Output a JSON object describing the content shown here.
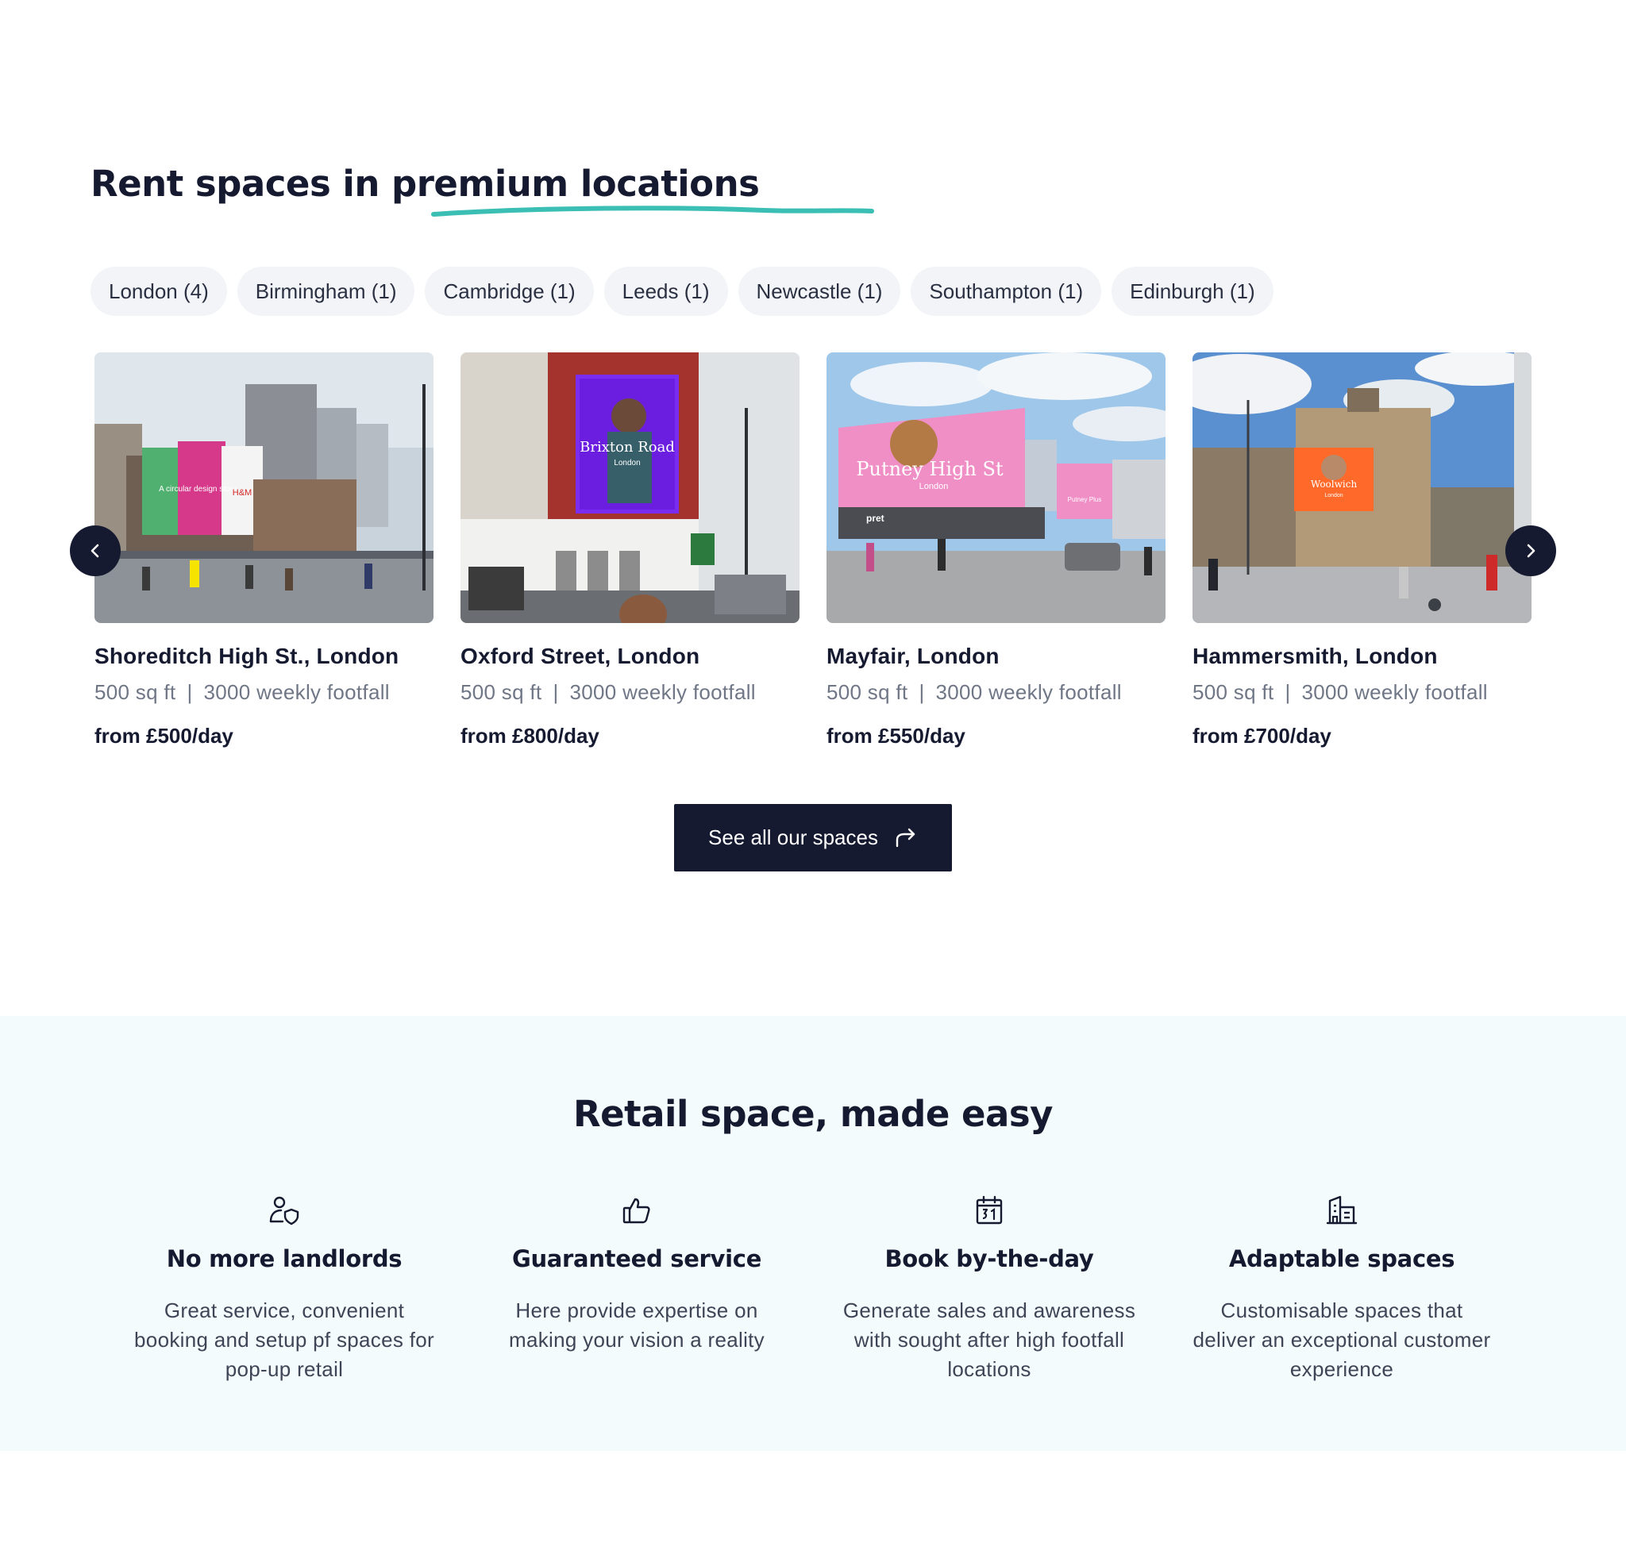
{
  "hero": {
    "title_part1": "Rent spaces in ",
    "title_highlight": "premium locations",
    "underline_color": "#3bbfb5"
  },
  "filters": [
    {
      "label": "London (4)"
    },
    {
      "label": "Birmingham (1)"
    },
    {
      "label": "Cambridge (1)"
    },
    {
      "label": "Leeds (1)"
    },
    {
      "label": "Newcastle (1)"
    },
    {
      "label": "Southampton (1)"
    },
    {
      "label": "Edinburgh (1)"
    }
  ],
  "carousel": {
    "prev_icon": "chevron-left-icon",
    "next_icon": "chevron-right-icon",
    "cards": [
      {
        "title": "Shoreditch High St., London",
        "size": "500 sq ft",
        "separator": "|",
        "footfall": "3000 weekly footfall",
        "price": "from £500/day",
        "billboard_text": "A circular design story",
        "billboard_brand": "H&M"
      },
      {
        "title": "Oxford Street, London",
        "size": "500 sq ft",
        "separator": "|",
        "footfall": "3000 weekly footfall",
        "price": "from £800/day",
        "billboard_text": "Brixton Road",
        "billboard_sub": "London"
      },
      {
        "title": "Mayfair, London",
        "size": "500 sq ft",
        "separator": "|",
        "footfall": "3000 weekly footfall",
        "price": "from £550/day",
        "billboard_text": "Putney High St",
        "billboard_sub": "London",
        "billboard_small": "Putney Plus",
        "shop_sign": "pret"
      },
      {
        "title": "Hammersmith, London",
        "size": "500 sq ft",
        "separator": "|",
        "footfall": "3000 weekly footfall",
        "price": "from £700/day",
        "billboard_text": "Woolwich",
        "billboard_sub": "London"
      }
    ]
  },
  "cta": {
    "label": "See all our spaces",
    "icon": "redo-arrow-icon"
  },
  "easy": {
    "title": "Retail space, made easy",
    "features": [
      {
        "icon": "user-shield-icon",
        "title": "No more landlords",
        "description": "Great service, convenient booking and setup pf spaces for pop-up retail"
      },
      {
        "icon": "thumbs-up-icon",
        "title": "Guaranteed service",
        "description": "Here provide expertise on making your vision a reality"
      },
      {
        "icon": "calendar-31-icon",
        "title": "Book by-the-day",
        "description": "Generate sales and awareness with sought after high footfall locations"
      },
      {
        "icon": "building-icon",
        "title": "Adaptable spaces",
        "description": "Customisable spaces that deliver an exceptional customer experience"
      }
    ]
  },
  "colors": {
    "navy": "#161a30",
    "chip_bg": "#f2f4f7",
    "easy_bg": "#f3fbfc",
    "muted_text": "#6f7686",
    "teal": "#3bbfb5"
  }
}
